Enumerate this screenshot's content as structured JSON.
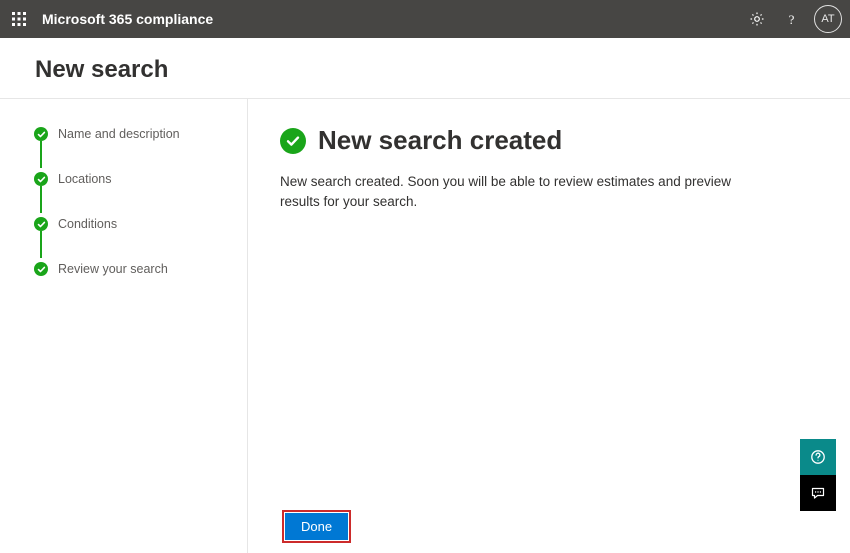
{
  "header": {
    "brand": "Microsoft 365 compliance",
    "avatar_initials": "AT"
  },
  "page": {
    "title": "New search"
  },
  "steps": [
    {
      "label": "Name and description"
    },
    {
      "label": "Locations"
    },
    {
      "label": "Conditions"
    },
    {
      "label": "Review your search"
    }
  ],
  "result": {
    "title": "New search created",
    "body": "New search created. Soon you will be able to review estimates and preview results for your search."
  },
  "actions": {
    "done_label": "Done"
  }
}
